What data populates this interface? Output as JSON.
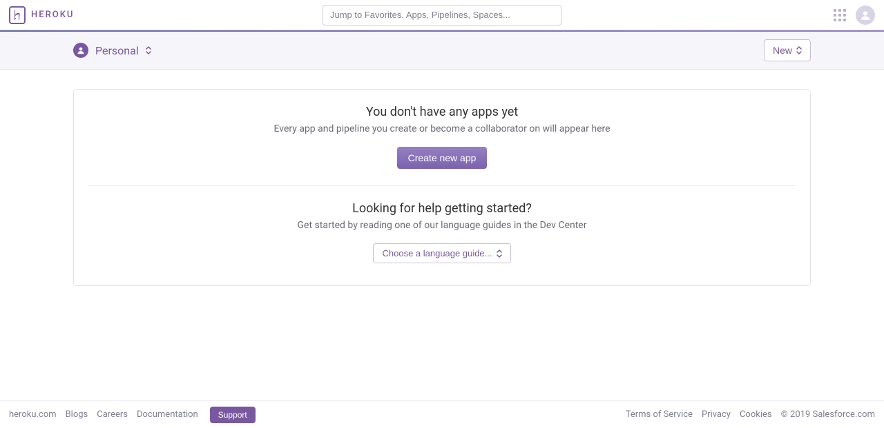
{
  "topbar": {
    "brand": "HEROKU",
    "search_placeholder": "Jump to Favorites, Apps, Pipelines, Spaces..."
  },
  "context": {
    "org_name": "Personal",
    "new_label": "New"
  },
  "empty": {
    "title": "You don't have any apps yet",
    "subtitle": "Every app and pipeline you create or become a collaborator on will appear here",
    "create_app_label": "Create new app"
  },
  "help": {
    "title": "Looking for help getting started?",
    "subtitle": "Get started by reading one of our language guides in the Dev Center",
    "choose_lang_label": "Choose a language guide..."
  },
  "footer": {
    "links": {
      "heroku": "heroku.com",
      "blogs": "Blogs",
      "careers": "Careers",
      "documentation": "Documentation"
    },
    "support_label": "Support",
    "legal": {
      "terms": "Terms of Service",
      "privacy": "Privacy",
      "cookies": "Cookies"
    },
    "copyright": "© 2019 Salesforce.com"
  }
}
